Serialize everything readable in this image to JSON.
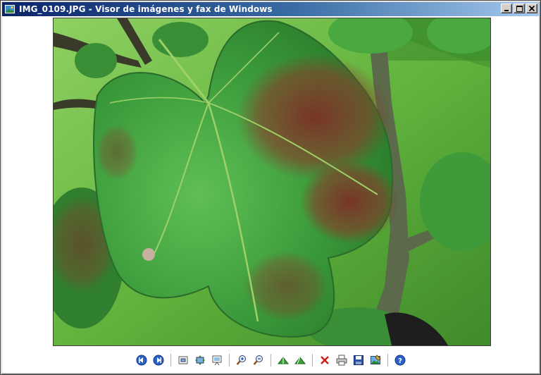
{
  "window": {
    "title": "IMG_0109.JPG - Visor de imágenes y fax de Windows",
    "icon": "image-viewer-icon"
  },
  "title_buttons": [
    "minimize-icon",
    "maximize-icon",
    "close-icon"
  ],
  "toolbar": {
    "groups": [
      [
        "previous-image-icon",
        "next-image-icon"
      ],
      [
        "best-fit-icon",
        "actual-size-icon",
        "slideshow-icon"
      ],
      [
        "zoom-in-icon",
        "zoom-out-icon"
      ],
      [
        "rotate-clockwise-icon",
        "rotate-counterclockwise-icon"
      ],
      [
        "delete-icon",
        "print-icon",
        "save-icon",
        "edit-icon"
      ],
      [
        "help-icon"
      ]
    ]
  },
  "colors": {
    "title_start": "#0a246a",
    "title_end": "#a6caf0",
    "window_face": "#d4d0c8",
    "leaf_green": "#3f9a3a",
    "leaf_rust": "#7a3a2a",
    "grass": "#5fb83a"
  },
  "photo": {
    "subject": "leaf-photo"
  }
}
